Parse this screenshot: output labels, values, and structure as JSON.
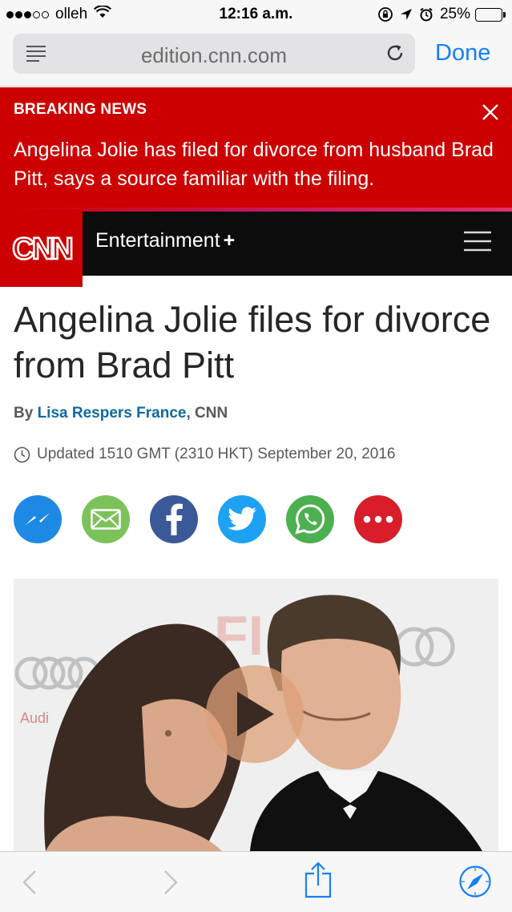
{
  "status_bar": {
    "carrier": "olleh",
    "time": "12:16 a.m.",
    "battery_percent": "25%",
    "battery_level": 0.25,
    "icons": [
      "signal-dots",
      "wifi-icon",
      "orientation-lock-icon",
      "location-icon",
      "alarm-icon",
      "battery-icon"
    ]
  },
  "browser": {
    "url": "edition.cnn.com",
    "done_label": "Done",
    "accent_color": "#157efb"
  },
  "breaking_news": {
    "label": "BREAKING NEWS",
    "text": "Angelina Jolie has filed for divorce from husband Brad Pitt, says a source familiar with the filing.",
    "color": "#cc0000"
  },
  "nav": {
    "logo": "CNN",
    "section": "Entertainment",
    "section_plus": "+"
  },
  "article": {
    "headline": "Angelina Jolie files for divorce from Brad Pitt",
    "byline_prefix": "By",
    "author": "Lisa Respers France",
    "byline_suffix": ", CNN",
    "updated": "Updated 1510 GMT (2310 HKT) September 20, 2016"
  },
  "share_buttons": [
    {
      "name": "messenger",
      "color": "#1e88e5"
    },
    {
      "name": "email",
      "color": "#7cc25a"
    },
    {
      "name": "facebook",
      "color": "#3b5998"
    },
    {
      "name": "twitter",
      "color": "#1da1f2"
    },
    {
      "name": "whatsapp",
      "color": "#4caf50"
    },
    {
      "name": "more",
      "color": "#d81e2a"
    }
  ],
  "video": {
    "watermark_brand": "Audi"
  },
  "toolbar": {
    "icons": [
      "back-icon",
      "forward-icon",
      "share-icon",
      "safari-compass-icon"
    ]
  }
}
